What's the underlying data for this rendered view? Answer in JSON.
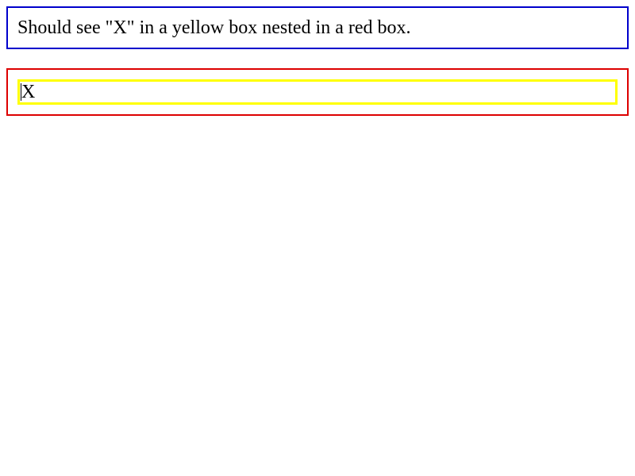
{
  "instruction": {
    "text": "Should see \"X\" in a yellow box nested in a red box.",
    "border_color": "#0000cc"
  },
  "outer_box": {
    "border_color": "#dd0000"
  },
  "inner_box": {
    "text": "X",
    "border_color": "#ffff00"
  }
}
